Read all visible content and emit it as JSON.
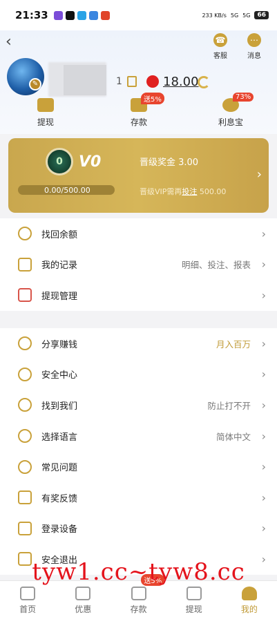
{
  "status_bar": {
    "time": "21:33",
    "network_speed": "233 KB/s",
    "signal_1": "5G",
    "signal_2": "5G",
    "battery": "66"
  },
  "header": {
    "back_icon": "chevron-left-icon",
    "service_label": "客服",
    "message_label": "消息"
  },
  "profile": {
    "uid_tail": "1",
    "balance": "18.00"
  },
  "quick_actions": [
    {
      "label": "提现",
      "badge": ""
    },
    {
      "label": "存款",
      "badge": "送5%"
    },
    {
      "label": "利息宝",
      "badge": "73%"
    }
  ],
  "vip": {
    "level": "V0",
    "medal_text": "0",
    "bonus": "晋级奖金 3.00",
    "progress_text": "0.00/500.00",
    "upgrade_prefix": "晋级VIP需再",
    "upgrade_link": "投注",
    "upgrade_amount": "500.00",
    "progress_fraction": 0
  },
  "menu_group_1": [
    {
      "label": "找回余额",
      "value": ""
    },
    {
      "label": "我的记录",
      "value": "明细、投注、报表"
    },
    {
      "label": "提现管理",
      "value": ""
    }
  ],
  "menu_group_2": [
    {
      "label": "分享赚钱",
      "value": "月入百万"
    },
    {
      "label": "安全中心",
      "value": ""
    },
    {
      "label": "找到我们",
      "value": "防止打不开"
    },
    {
      "label": "选择语言",
      "value": "简体中文"
    },
    {
      "label": "常见问题",
      "value": ""
    },
    {
      "label": "有奖反馈",
      "value": ""
    },
    {
      "label": "登录设备",
      "value": ""
    },
    {
      "label": "安全退出",
      "value": ""
    }
  ],
  "watermark": "tyw1.cc~tyw8.cc",
  "tabbar": [
    {
      "label": "首页",
      "badge": ""
    },
    {
      "label": "优惠",
      "badge": ""
    },
    {
      "label": "存款",
      "badge": "送5%"
    },
    {
      "label": "提现",
      "badge": ""
    },
    {
      "label": "我的",
      "badge": ""
    }
  ],
  "colors": {
    "accent": "#c9a13a",
    "badge": "#e8452e",
    "watermark": "#e4121b"
  }
}
